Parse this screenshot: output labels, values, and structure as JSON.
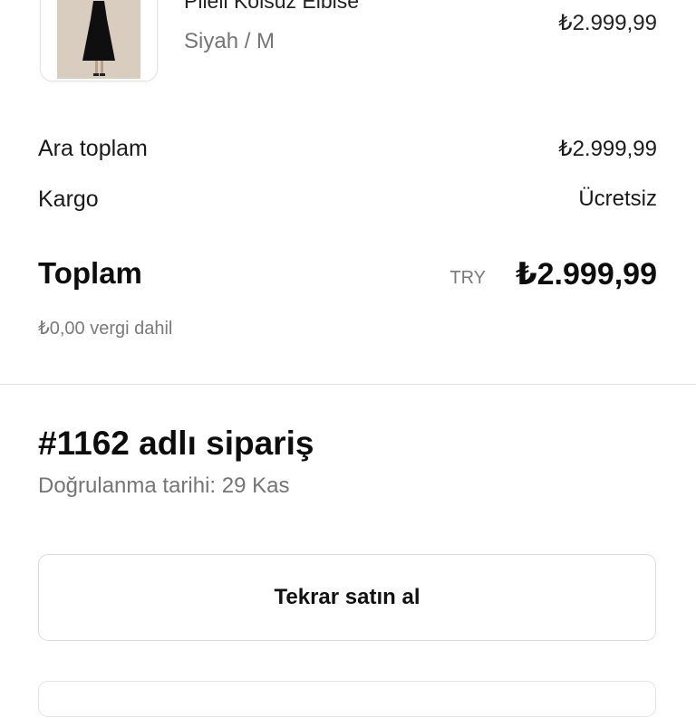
{
  "product": {
    "name": "Pileli Kolsuz Elbise",
    "variant": "Siyah / M",
    "price": "₺2.999,99"
  },
  "summary": {
    "subtotal_label": "Ara toplam",
    "subtotal_value": "₺2.999,99",
    "shipping_label": "Kargo",
    "shipping_value": "Ücretsiz",
    "total_label": "Toplam",
    "total_currency": "TRY",
    "total_value": "₺2.999,99",
    "tax_note": "₺0,00 vergi dahil"
  },
  "order": {
    "title": "#1162 adlı sipariş",
    "confirmation": "Doğrulanma tarihi: 29 Kas"
  },
  "actions": {
    "rebuy_label": "Tekrar satın al"
  }
}
